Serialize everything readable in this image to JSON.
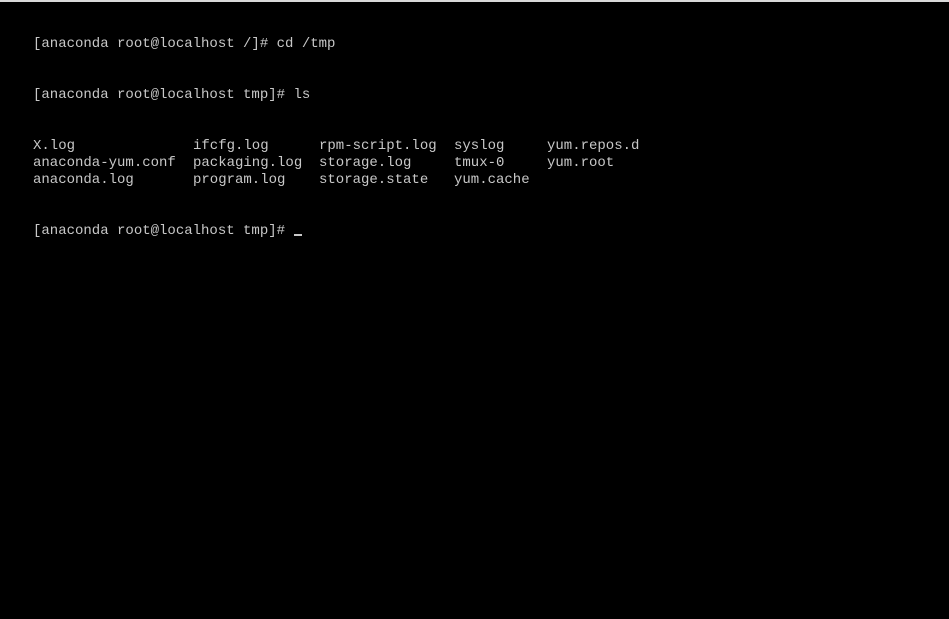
{
  "terminal": {
    "lines": [
      "[anaconda root@localhost /]# cd /tmp",
      "[anaconda root@localhost tmp]# ls"
    ],
    "ls_rows": [
      [
        "X.log",
        "ifcfg.log",
        "rpm-script.log",
        "syslog",
        "yum.repos.d"
      ],
      [
        "anaconda-yum.conf",
        "packaging.log",
        "storage.log",
        "tmux-0",
        "yum.root"
      ],
      [
        "anaconda.log",
        "program.log",
        "storage.state",
        "yum.cache",
        ""
      ]
    ],
    "prompt": "[anaconda root@localhost tmp]# ",
    "text_color": "#c8c8c8",
    "background": "#000000"
  }
}
